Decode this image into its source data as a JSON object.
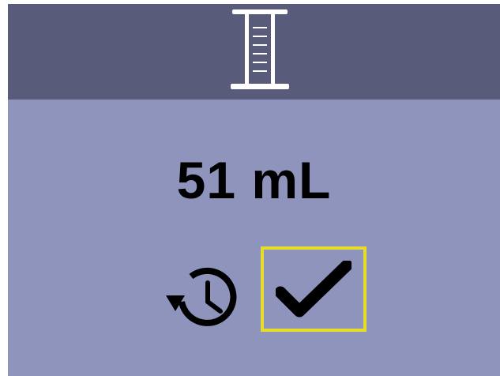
{
  "header": {
    "icon": "graduated-cylinder-icon"
  },
  "measurement": {
    "value_text": "51 mL"
  },
  "actions": {
    "history_icon": "history-icon",
    "confirm_icon": "checkmark-icon",
    "selected_action": "confirm"
  },
  "colors": {
    "header_bg": "#595b7b",
    "body_bg": "#8e94bc",
    "selection_border": "#e8dc2a",
    "icon_header": "#ffffff",
    "icon_body": "#000000"
  }
}
